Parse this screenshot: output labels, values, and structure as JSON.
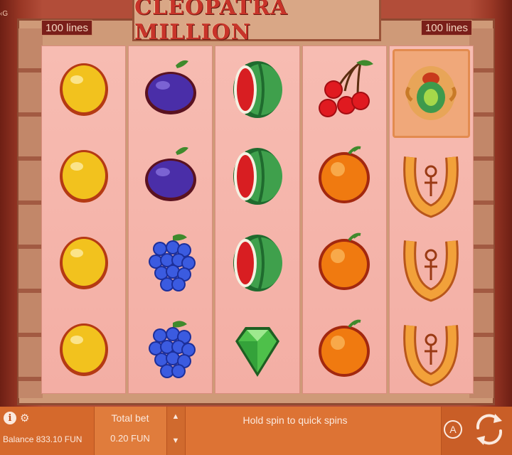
{
  "corner_tag": "‹G",
  "game": {
    "title": "CLEOPATRA MILLION",
    "lines_left": "100 lines",
    "lines_right": "100 lines"
  },
  "reels": [
    [
      "lemon",
      "lemon",
      "lemon",
      "lemon"
    ],
    [
      "plum",
      "plum",
      "grapes",
      "grapes"
    ],
    [
      "watermelon",
      "watermelon",
      "watermelon",
      "diamond"
    ],
    [
      "cherries",
      "orange",
      "orange",
      "orange"
    ],
    [
      "scarab",
      "horseshoe",
      "horseshoe",
      "horseshoe"
    ]
  ],
  "highlighted_symbol": "scarab",
  "bottom_bar": {
    "info_icon": "i",
    "balance_label": "Balance",
    "balance_value": "833.10 FUN",
    "bet_label": "Total bet",
    "bet_value": "0.20 FUN",
    "hint": "Hold spin to quick spins",
    "auto_label": "A",
    "arrow_up": "▲",
    "arrow_down": "▼",
    "gear": "⚙"
  },
  "colors": {
    "accent": "#d96f33",
    "title_red": "#c8342a",
    "reel_bg": "#f7bcb2"
  }
}
